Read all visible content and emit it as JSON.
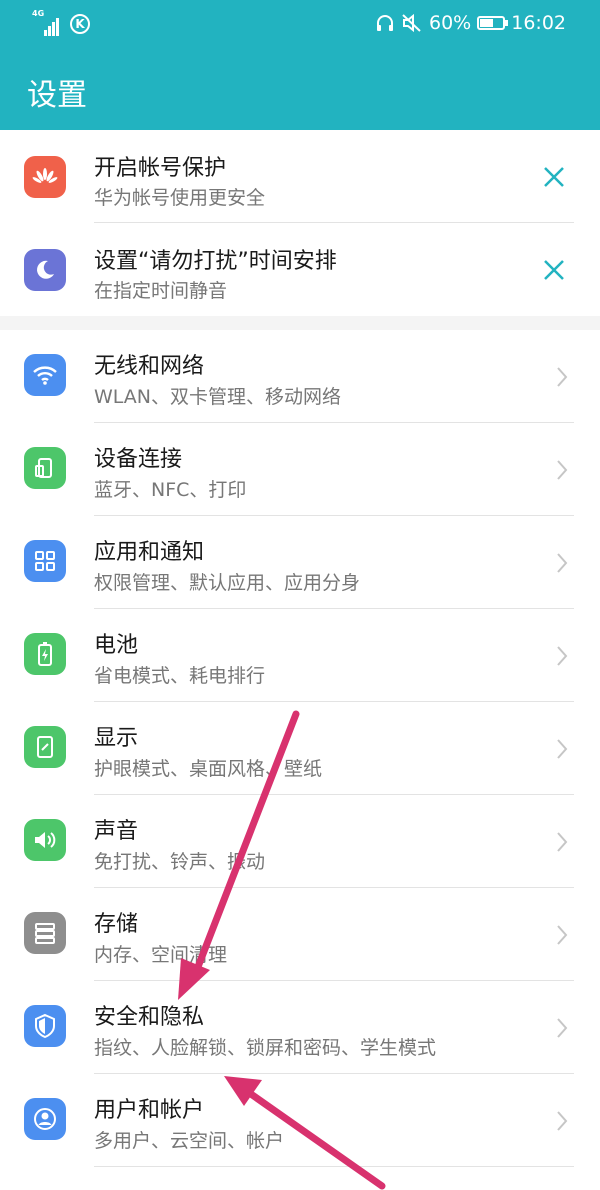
{
  "status_bar": {
    "network": "4G",
    "battery_percent": "60%",
    "time": "16:02"
  },
  "header": {
    "title": "设置"
  },
  "suggestions": [
    {
      "title": "开启帐号保护",
      "subtitle": "华为帐号使用更安全",
      "icon": "huawei-logo-icon",
      "color": "#f0614a"
    },
    {
      "title": "设置“请勿打扰”时间安排",
      "subtitle": "在指定时间静音",
      "icon": "moon-icon",
      "color": "#6b74d6"
    }
  ],
  "settings": [
    {
      "title": "无线和网络",
      "subtitle": "WLAN、双卡管理、移动网络",
      "icon": "wifi-icon",
      "color": "#4c8ff0"
    },
    {
      "title": "设备连接",
      "subtitle": "蓝牙、NFC、打印",
      "icon": "device-connection-icon",
      "color": "#4dc66a"
    },
    {
      "title": "应用和通知",
      "subtitle": "权限管理、默认应用、应用分身",
      "icon": "apps-grid-icon",
      "color": "#4c8ff0"
    },
    {
      "title": "电池",
      "subtitle": "省电模式、耗电排行",
      "icon": "battery-icon",
      "color": "#4dc66a"
    },
    {
      "title": "显示",
      "subtitle": "护眼模式、桌面风格、壁纸",
      "icon": "display-icon",
      "color": "#4dc66a"
    },
    {
      "title": "声音",
      "subtitle": "免打扰、铃声、振动",
      "icon": "speaker-icon",
      "color": "#4dc66a"
    },
    {
      "title": "存储",
      "subtitle": "内存、空间清理",
      "icon": "storage-icon",
      "color": "#8e8e8e"
    },
    {
      "title": "安全和隐私",
      "subtitle": "指纹、人脸解锁、锁屏和密码、学生模式",
      "icon": "shield-icon",
      "color": "#4c8ff0"
    },
    {
      "title": "用户和帐户",
      "subtitle": "多用户、云空间、帐户",
      "icon": "user-icon",
      "color": "#4c8ff0"
    }
  ],
  "annotation_color": "#d8326e"
}
